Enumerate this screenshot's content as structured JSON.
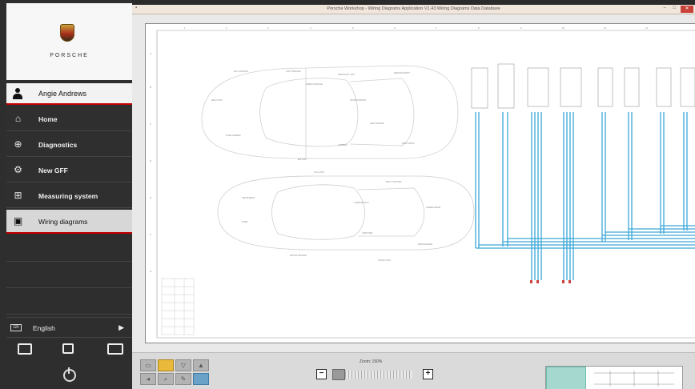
{
  "window": {
    "title": "Porsche Workshop - Wiring Diagrams Application V1.43 Wiring Diagrams Data Database"
  },
  "sidebar": {
    "brand": "PORSCHE",
    "user": "Angie Andrews",
    "items": [
      {
        "label": "Home",
        "icon": "home-icon"
      },
      {
        "label": "Diagnostics",
        "icon": "diagnostics-icon"
      },
      {
        "label": "New GFF",
        "icon": "gff-icon"
      },
      {
        "label": "Measuring system",
        "icon": "measuring-icon"
      },
      {
        "label": "Wiring diagrams",
        "icon": "wiring-icon",
        "active": true
      }
    ],
    "language": "English"
  },
  "toolbar": {
    "zoom_label": "Zoom: 150%"
  },
  "colors": {
    "accent": "#c40000",
    "wire": "#3aa8d8",
    "sidebar_bg": "#2e2e2e"
  }
}
